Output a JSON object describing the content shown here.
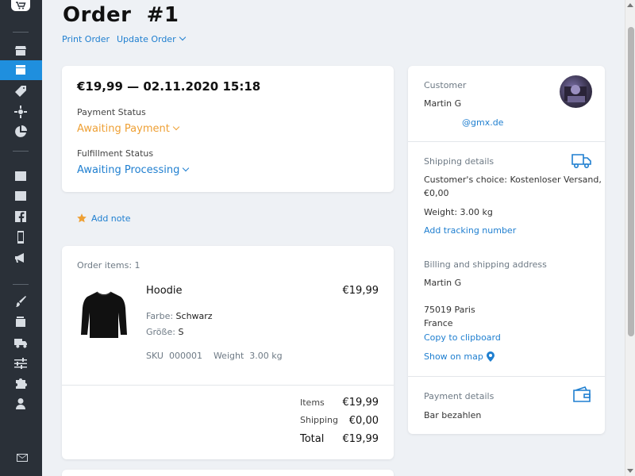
{
  "header": {
    "title": "Order  #1",
    "print_label": "Print Order",
    "update_label": "Update Order"
  },
  "summary": {
    "date_line": "€19,99 — 02.11.2020 15:18",
    "payment_status_label": "Payment Status",
    "payment_status_value": "Awaiting Payment",
    "fulfillment_status_label": "Fulfillment Status",
    "fulfillment_status_value": "Awaiting Processing"
  },
  "notes": {
    "add_label": "Add note"
  },
  "items": {
    "count_label": "Order items: 1",
    "product": {
      "name": "Hoodie",
      "price": "€19,99",
      "color_label": "Farbe:",
      "color_value": "Schwarz",
      "size_label": "Größe:",
      "size_value": "S",
      "sku_label": "SKU",
      "sku_value": "000001",
      "weight_label": "Weight",
      "weight_value": "3.00 kg"
    },
    "totals": {
      "items_label": "Items",
      "items_value": "€19,99",
      "shipping_label": "Shipping",
      "shipping_value": "€0,00",
      "total_label": "Total",
      "total_value": "€19,99"
    }
  },
  "customer": {
    "label": "Customer",
    "name": "Martin G",
    "email": "@gmx.de"
  },
  "shipping": {
    "label": "Shipping details",
    "choice_line1": "Customer's choice: Kostenloser Versand,",
    "choice_line2": "€0,00",
    "weight": "Weight: 3.00 kg",
    "tracking_link": "Add tracking number"
  },
  "address": {
    "label": "Billing and shipping address",
    "name": "Martin G",
    "city": "75019 Paris",
    "country": "France",
    "copy_link": "Copy to clipboard",
    "map_link": "Show on map"
  },
  "payment": {
    "label": "Payment details",
    "method": "Bar bezahlen"
  },
  "colors": {
    "accent": "#1f7fd0",
    "warning": "#eea035",
    "sidebar": "#2a3038",
    "sidebar_active": "#1f8fde"
  },
  "icons": {
    "sidebar": [
      "shop-logo-icon",
      "store-icon",
      "orders-icon",
      "tag-icon",
      "crosshair-icon",
      "pie-chart-icon",
      "storefront-icon",
      "browser-icon",
      "facebook-icon",
      "mobile-icon",
      "megaphone-icon",
      "brush-icon",
      "wallet-icon",
      "truck-icon",
      "sliders-icon",
      "puzzle-icon",
      "user-icon",
      "envelope-icon"
    ]
  }
}
